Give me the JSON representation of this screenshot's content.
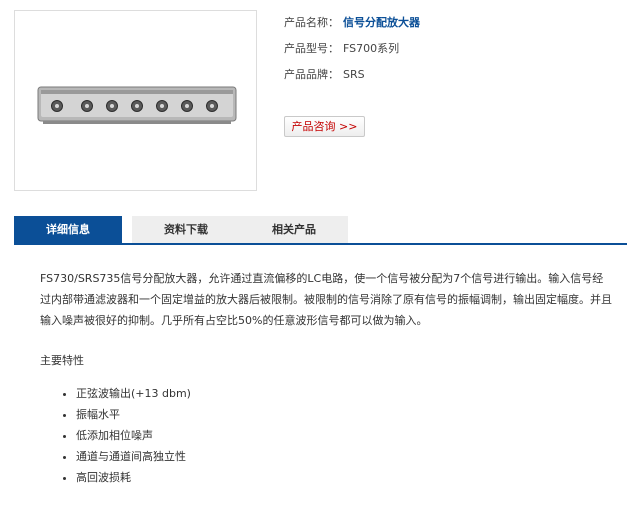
{
  "product": {
    "name_label": "产品名称：",
    "name": "信号分配放大器",
    "model_label": "产品型号：",
    "model": "FS700系列",
    "brand_label": "产品品牌：",
    "brand": "SRS",
    "consult_label": "产品咨询 >>"
  },
  "tabs": [
    {
      "label": "详细信息",
      "active": true
    },
    {
      "label": "资料下载",
      "active": false
    },
    {
      "label": "相关产品",
      "active": false
    }
  ],
  "description": "FS730/SRS735信号分配放大器，允许通过直流偏移的LC电路，使一个信号被分配为7个信号进行输出。输入信号经过内部带通滤波器和一个固定增益的放大器后被限制。被限制的信号消除了原有信号的振幅调制，输出固定幅度。并且输入噪声被很好的抑制。几乎所有占空比50%的任意波形信号都可以做为输入。",
  "features_title": "主要特性",
  "features": [
    "正弦波输出(+13 dbm)",
    "振幅水平",
    "低添加相位噪声",
    "通道与通道间高独立性",
    "高回波损耗"
  ],
  "colors": {
    "accent": "#0b4f97",
    "consult_text": "#c40000",
    "tab_inactive": "#eeeeee"
  }
}
